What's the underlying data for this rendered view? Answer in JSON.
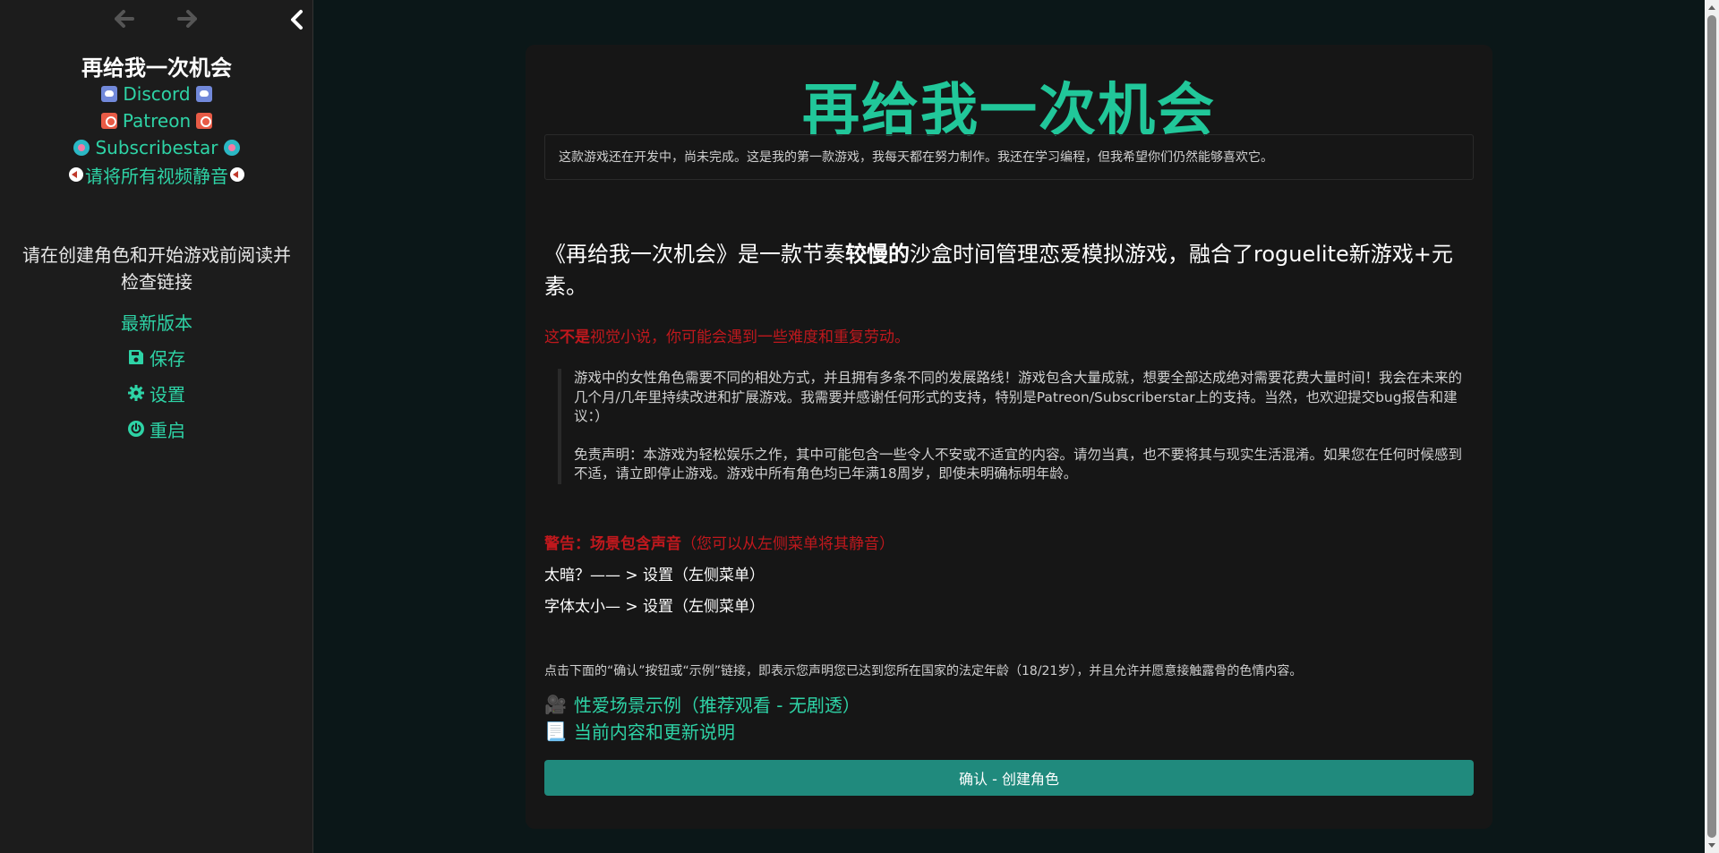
{
  "sidebar": {
    "title": "再给我一次机会",
    "links": [
      {
        "label": "Discord",
        "icon": "discord-icon"
      },
      {
        "label": "Patreon",
        "icon": "patreon-icon"
      },
      {
        "label": "Subscribestar",
        "icon": "subscribestar-icon"
      },
      {
        "label": "请将所有视频静音",
        "icon": "mute-icon"
      }
    ],
    "notice": "请在创建角色和开始游戏前阅读并检查链接",
    "menu": [
      {
        "label": "最新版本",
        "icon": ""
      },
      {
        "label": "保存",
        "icon": "save-icon"
      },
      {
        "label": "设置",
        "icon": "gear-icon"
      },
      {
        "label": "重启",
        "icon": "power-icon"
      }
    ]
  },
  "main": {
    "game_title": "再给我一次机会",
    "dev_notice": "这款游戏还在开发中，尚未完成。这是我的第一款游戏，我每天都在努力制作。我还在学习编程，但我希望你们仍然能够喜欢它。",
    "intro": {
      "part1": "《再给我一次机会》是一款节奏",
      "bold": "较慢的",
      "part2": "沙盒时间管理恋爱模拟游戏，融合了roguelite新游戏+元素。"
    },
    "not_novel": {
      "part1": "这",
      "bold": "不是",
      "part2": "视觉小说，你可能会遇到一些难度和重复劳动。"
    },
    "quote": {
      "p1": "游戏中的女性角色需要不同的相处方式，并且拥有多条不同的发展路线！游戏包含大量成就，想要全部达成绝对需要花费大量时间！我会在未来的几个月/几年里持续改进和扩展游戏。我需要并感谢任何形式的支持，特别是Patreon/Subscriberstar上的支持。当然，也欢迎提交bug报告和建议：）",
      "p2": "免责声明：本游戏为轻松娱乐之作，其中可能包含一些令人不安或不适宜的内容。请勿当真，也不要将其与现实生活混淆。如果您在任何时候感到不适，请立即停止游戏。游戏中所有角色均已年满18周岁，即使未明确标明年龄。"
    },
    "warning": {
      "bold": "警告：场景包含声音",
      "rest": "（您可以从左侧菜单将其静音）"
    },
    "tip_dark": "太暗？—— > 设置（左侧菜单）",
    "tip_font": "字体太小— > 设置（左侧菜单）",
    "consent": "点击下面的“确认”按钮或“示例”链接，即表示您声明您已达到您所在国家的法定年龄（18/21岁），并且允许并愿意接触露骨的色情内容。",
    "link_example": {
      "emoji": "🎥",
      "label": "性爱场景示例（推荐观看 - 无剧透）"
    },
    "link_changelog": {
      "emoji": "📃",
      "label": "当前内容和更新说明"
    },
    "confirm_label": "确认 - 创建角色"
  },
  "colors": {
    "accent": "#2ed3a6",
    "title": "#21c79a",
    "warning": "#c0181d",
    "button": "#208a7d",
    "sidebar_bg": "#1c1c1c",
    "page_bg": "#0b1718",
    "card_bg": "#161616"
  }
}
